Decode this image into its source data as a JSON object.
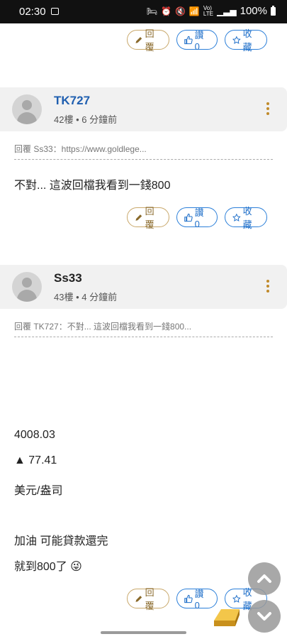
{
  "status": {
    "time": "02:30",
    "battery": "100%",
    "icons": [
      "image-icon",
      "hotel-icon",
      "alarm-icon",
      "mute-icon",
      "wifi-icon",
      "volte-icon",
      "signal-icon",
      "battery-icon"
    ]
  },
  "actions": {
    "reply": "回覆",
    "like": "讚 0",
    "favorite": "收藏"
  },
  "posts": [
    {
      "username": "TK727",
      "username_color": "#1f5fb0",
      "meta": "42樓 • 6 分鐘前",
      "quote": "回覆 Ss33：https://www.goldlege...",
      "lines": [
        "不對... 這波回檔我看到一錢800"
      ]
    },
    {
      "username": "Ss33",
      "username_color": "#222222",
      "meta": "43樓 • 4 分鐘前",
      "quote": "回覆 TK727：不對... 這波回檔我看到一錢800...",
      "lines": [
        "4008.03",
        "▲ 77.41",
        "美元/盎司",
        "加油 可能貸款還完",
        "就到800了 😜"
      ]
    }
  ]
}
